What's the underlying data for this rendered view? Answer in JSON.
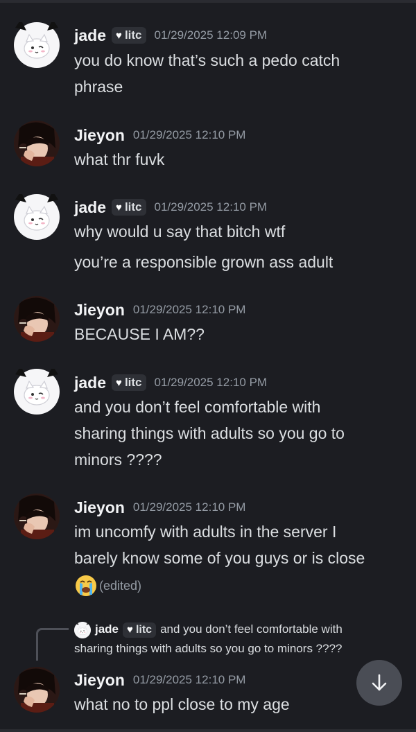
{
  "messages": [
    {
      "author": "jade",
      "avatar": "white-cat-avatar",
      "tag": "litc",
      "timestamp": "01/29/2025 12:09 PM",
      "lines": [
        "you do know that’s such a pedo catch",
        "phrase"
      ]
    },
    {
      "author": "Jieyon",
      "avatar": "anime-boy-avatar",
      "timestamp": "01/29/2025 12:10 PM",
      "lines": [
        "what thr fuvk"
      ]
    },
    {
      "author": "jade",
      "avatar": "white-cat-avatar",
      "tag": "litc",
      "timestamp": "01/29/2025 12:10 PM",
      "lines": [
        "why would u say that bitch wtf",
        "you’re a responsible grown ass adult"
      ]
    },
    {
      "author": "Jieyon",
      "avatar": "anime-boy-avatar",
      "timestamp": "01/29/2025 12:10 PM",
      "lines": [
        "BECAUSE I AM??"
      ]
    },
    {
      "author": "jade",
      "avatar": "white-cat-avatar",
      "tag": "litc",
      "timestamp": "01/29/2025 12:10 PM",
      "lines": [
        "and you don’t feel comfortable with",
        "sharing things with adults so you go to",
        "minors ????"
      ]
    },
    {
      "author": "Jieyon",
      "avatar": "anime-boy-avatar",
      "timestamp": "01/29/2025 12:10 PM",
      "lines": [
        "im uncomfy with adults in the server I",
        "barely know some of you guys or is close"
      ],
      "emoji": "loudly-crying-face-emoji",
      "edited": "(edited)"
    },
    {
      "author": "Jieyon",
      "avatar": "anime-boy-avatar",
      "timestamp": "01/29/2025 12:10 PM",
      "lines": [
        "what no to ppl close to my age"
      ],
      "reply_to": {
        "author": "jade",
        "tag": "litc",
        "line1": "and you don’t feel comfortable with",
        "line2": "sharing things with adults so you go to minors ????"
      }
    }
  ],
  "scroll_button": {
    "icon": "arrow-down-icon"
  },
  "colors": {
    "background": "#1c1d22",
    "text": "#dbdee1",
    "muted": "#949ba4",
    "tag_bg": "#2e3036"
  }
}
